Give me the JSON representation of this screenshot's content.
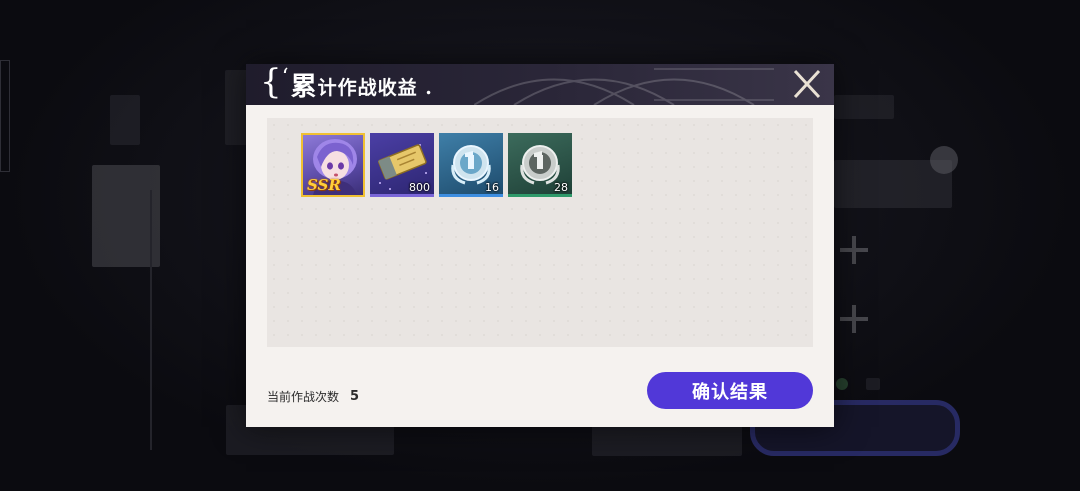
{
  "dialog": {
    "title_brace": "{",
    "title_quote": "‘",
    "title_first_char": "累",
    "title_rest": "计作战收益 .",
    "close_icon": "close-x-icon"
  },
  "rewards": [
    {
      "kind": "character",
      "rarity_label": "SSR",
      "icon": "purple-hair-character-portrait",
      "count": ""
    },
    {
      "kind": "ticket",
      "icon": "gold-ticket-icon",
      "count": "800"
    },
    {
      "kind": "medal-blue",
      "icon": "blue-laurel-medal-icon",
      "count": "16"
    },
    {
      "kind": "medal-green",
      "icon": "green-laurel-medal-icon",
      "count": "28"
    }
  ],
  "footer": {
    "battle_count_label": "当前作战次数",
    "battle_count_value": "5",
    "confirm_label": "确认结果"
  },
  "colors": {
    "accent": "#5138d8",
    "header": "#2b2739",
    "panel": "#f5f2ef",
    "ssr_border": "#f0c032"
  }
}
